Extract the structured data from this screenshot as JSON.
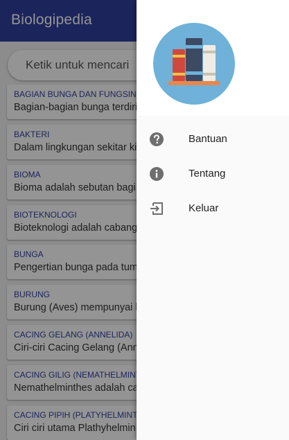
{
  "app": {
    "title": "Biologipedia"
  },
  "search": {
    "placeholder": "Ketik untuk mencari"
  },
  "list": [
    {
      "title": "BAGIAN BUNGA DAN FUNGSINYA",
      "desc": "Bagian-bagian bunga terdiri"
    },
    {
      "title": "BAKTERI",
      "desc": "Dalam lingkungan sekitar ki"
    },
    {
      "title": "BIOMA",
      "desc": "Bioma adalah sebutan bagi"
    },
    {
      "title": "BIOTEKNOLOGI",
      "desc": "Bioteknologi adalah cabang"
    },
    {
      "title": "BUNGA",
      "desc": "Pengertian bunga pada tum"
    },
    {
      "title": "BURUNG",
      "desc": "Burung (Aves) mempunyai b"
    },
    {
      "title": "CACING GELANG (ANNELIDA)",
      "desc": "Ciri-ciri Cacing Gelang (Ann"
    },
    {
      "title": "CACING GILIG (NEMATHELMINTHES)",
      "desc": "Nemathelminthes adalah ca"
    },
    {
      "title": "CACING PIPIH (PLATYHELMINTHES)",
      "desc": "Ciri ciri utama Plathyhelmin"
    }
  ],
  "drawer": {
    "logo_icon": "bookshelf-logo",
    "menu": [
      {
        "label": "Bantuan",
        "icon": "help-icon"
      },
      {
        "label": "Tentang",
        "icon": "info-icon"
      },
      {
        "label": "Keluar",
        "icon": "exit-icon"
      }
    ]
  },
  "colors": {
    "primary": "#2f3f9e",
    "logo_bg": "#6fb1d8"
  }
}
